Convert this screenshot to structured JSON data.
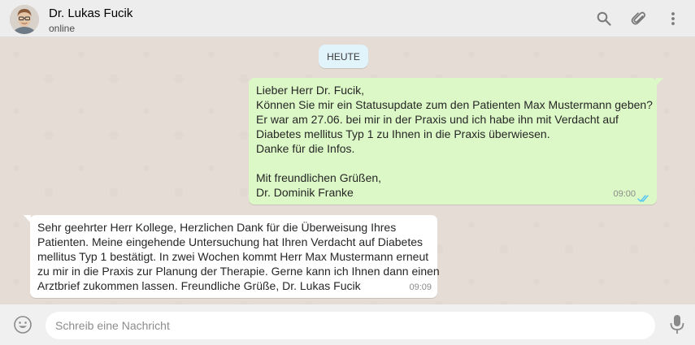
{
  "header": {
    "contact_name": "Dr. Lukas Fucik",
    "status": "online",
    "icons": [
      "search-icon",
      "attach-icon",
      "menu-icon"
    ]
  },
  "chat": {
    "date_label": "HEUTE",
    "messages": [
      {
        "direction": "outgoing",
        "lines": [
          "Lieber Herr Dr. Fucik,",
          "Können Sie mir ein Statusupdate zum den Patienten Max Mustermann geben?",
          "Er war am 27.06. bei mir in der Praxis und ich habe ihn mit Verdacht auf",
          "Diabetes mellitus Typ 1 zu Ihnen in die Praxis überwiesen.",
          "Danke für die Infos.",
          "",
          "Mit freundlichen Grüßen,",
          "Dr. Dominik Franke"
        ],
        "time": "09:00",
        "status": "read"
      },
      {
        "direction": "incoming",
        "lines": [
          "Sehr geehrter Herr Kollege, Herzlichen Dank für die Überweisung Ihres",
          "Patienten. Meine eingehende Untersuchung hat Ihren Verdacht auf Diabetes",
          "mellitus Typ 1 bestätigt. In zwei Wochen kommt Herr Max Mustermann erneut",
          "zu mir in die Praxis zur Planung der Therapie. Gerne kann ich Ihnen dann einen",
          "Arztbrief zukommen lassen. Freundliche Grüße, Dr. Lukas Fucik"
        ],
        "time": "09:09"
      }
    ]
  },
  "composer": {
    "placeholder": "Schreib eine Nachricht",
    "icons": [
      "emoji-icon",
      "microphone-icon"
    ]
  },
  "colors": {
    "outgoing_bubble": "#dcf8c6",
    "incoming_bubble": "#ffffff",
    "read_ticks": "#4fc3f7",
    "date_pill": "#e1f3fb"
  }
}
